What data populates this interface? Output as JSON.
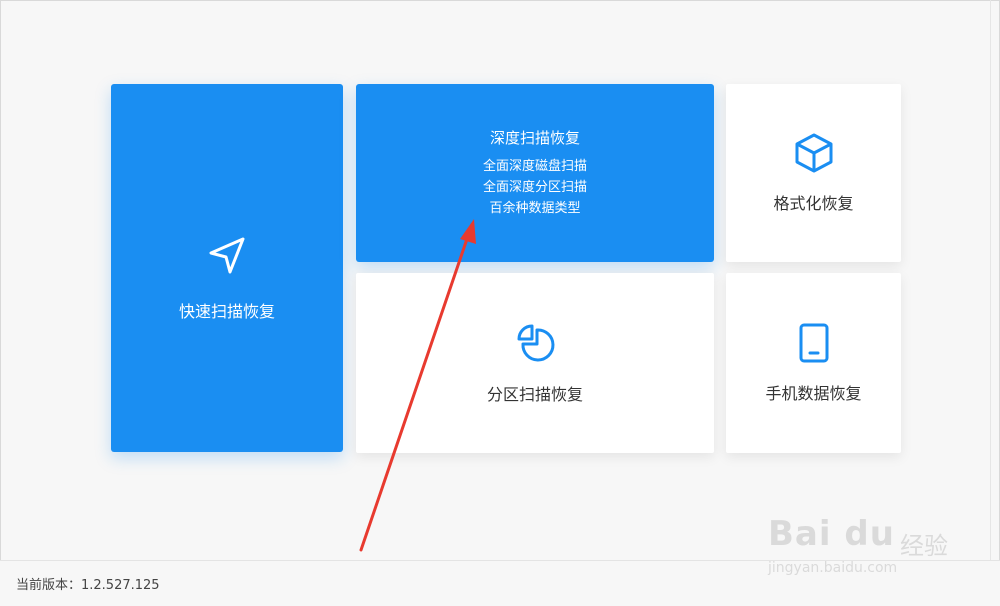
{
  "tiles": {
    "quick": {
      "label": "快速扫描恢复",
      "icon": "navigation-arrow-icon"
    },
    "deep": {
      "title": "深度扫描恢复",
      "lines": [
        "全面深度磁盘扫描",
        "全面深度分区扫描",
        "百余种数据类型"
      ]
    },
    "format": {
      "label": "格式化恢复",
      "icon": "cube-icon"
    },
    "partition": {
      "label": "分区扫描恢复",
      "icon": "pie-chart-icon"
    },
    "phone": {
      "label": "手机数据恢复",
      "icon": "tablet-icon"
    }
  },
  "footer": {
    "version": "当前版本：1.2.527.125"
  },
  "watermark": {
    "brand": "Bai du",
    "cn": "经验",
    "url": "jingyan.baidu.com"
  },
  "colors": {
    "accent": "#1a8ef2",
    "annotation": "#e83a2f"
  }
}
